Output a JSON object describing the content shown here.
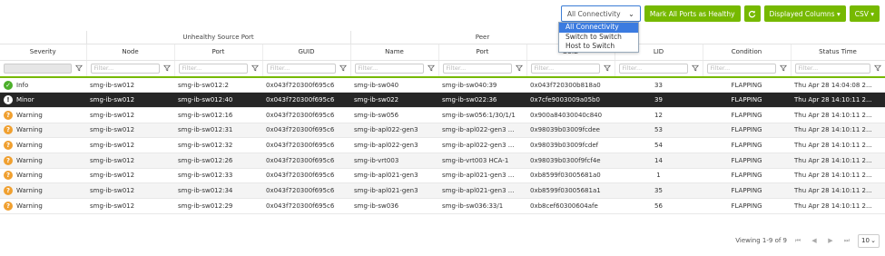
{
  "toolbar": {
    "connectivity_value": "All Connectivity",
    "mark_label": "Mark All Ports as Healthy",
    "refresh_icon": "refresh-icon",
    "displayed_columns_label": "Displayed Columns ▾",
    "csv_label": "CSV ▾"
  },
  "dropdown": {
    "options": [
      "All Connectivity",
      "Switch to Switch",
      "Host to Switch"
    ]
  },
  "groups": {
    "unhealthy": "Unhealthy Source Port",
    "peer": "Peer"
  },
  "columns": [
    "Severity",
    "Node",
    "Port",
    "GUID",
    "Name",
    "Port",
    "GUID",
    "LID",
    "Condition",
    "Status Time"
  ],
  "filter_placeholder": "Filter...",
  "rows": [
    {
      "severity": "Info",
      "node": "smg-ib-sw012",
      "port": "smg-ib-sw012:2",
      "guid": "0x043f720300f695c6",
      "peer_name": "smg-ib-sw040",
      "peer_port": "smg-ib-sw040:39",
      "peer_guid": "0x043f720300b818a0",
      "lid": "33",
      "condition": "FLAPPING",
      "time": "Thu Apr 28 14:04:08 2..."
    },
    {
      "severity": "Minor",
      "node": "smg-ib-sw012",
      "port": "smg-ib-sw012:40",
      "guid": "0x043f720300f695c6",
      "peer_name": "smg-ib-sw022",
      "peer_port": "smg-ib-sw022:36",
      "peer_guid": "0x7cfe9003009a05b0",
      "lid": "39",
      "condition": "FLAPPING",
      "time": "Thu Apr 28 14:10:11 2..."
    },
    {
      "severity": "Warning",
      "node": "smg-ib-sw012",
      "port": "smg-ib-sw012:16",
      "guid": "0x043f720300f695c6",
      "peer_name": "smg-ib-sw056",
      "peer_port": "smg-ib-sw056:1/30/1/1",
      "peer_guid": "0x900a84030040c840",
      "lid": "12",
      "condition": "FLAPPING",
      "time": "Thu Apr 28 14:10:11 2..."
    },
    {
      "severity": "Warning",
      "node": "smg-ib-sw012",
      "port": "smg-ib-sw012:31",
      "guid": "0x043f720300f695c6",
      "peer_name": "smg-ib-apl022-gen3",
      "peer_port": "smg-ib-apl022-gen3 ...",
      "peer_guid": "0x98039b03009fcdee",
      "lid": "53",
      "condition": "FLAPPING",
      "time": "Thu Apr 28 14:10:11 2..."
    },
    {
      "severity": "Warning",
      "node": "smg-ib-sw012",
      "port": "smg-ib-sw012:32",
      "guid": "0x043f720300f695c6",
      "peer_name": "smg-ib-apl022-gen3",
      "peer_port": "smg-ib-apl022-gen3 ...",
      "peer_guid": "0x98039b03009fcdef",
      "lid": "54",
      "condition": "FLAPPING",
      "time": "Thu Apr 28 14:10:11 2..."
    },
    {
      "severity": "Warning",
      "node": "smg-ib-sw012",
      "port": "smg-ib-sw012:26",
      "guid": "0x043f720300f695c6",
      "peer_name": "smg-ib-vrt003",
      "peer_port": "smg-ib-vrt003 HCA-1",
      "peer_guid": "0x98039b0300f9fcf4e",
      "lid": "14",
      "condition": "FLAPPING",
      "time": "Thu Apr 28 14:10:11 2..."
    },
    {
      "severity": "Warning",
      "node": "smg-ib-sw012",
      "port": "smg-ib-sw012:33",
      "guid": "0x043f720300f695c6",
      "peer_name": "smg-ib-apl021-gen3",
      "peer_port": "smg-ib-apl021-gen3 ...",
      "peer_guid": "0xb8599f03005681a0",
      "lid": "1",
      "condition": "FLAPPING",
      "time": "Thu Apr 28 14:10:11 2..."
    },
    {
      "severity": "Warning",
      "node": "smg-ib-sw012",
      "port": "smg-ib-sw012:34",
      "guid": "0x043f720300f695c6",
      "peer_name": "smg-ib-apl021-gen3",
      "peer_port": "smg-ib-apl021-gen3 ...",
      "peer_guid": "0xb8599f03005681a1",
      "lid": "35",
      "condition": "FLAPPING",
      "time": "Thu Apr 28 14:10:11 2..."
    },
    {
      "severity": "Warning",
      "node": "smg-ib-sw012",
      "port": "smg-ib-sw012:29",
      "guid": "0x043f720300f695c6",
      "peer_name": "smg-ib-sw036",
      "peer_port": "smg-ib-sw036:33/1",
      "peer_guid": "0xb8cef60300604afe",
      "lid": "56",
      "condition": "FLAPPING",
      "time": "Thu Apr 28 14:10:11 2..."
    }
  ],
  "pager": {
    "viewing": "Viewing 1-9 of 9",
    "page_size": "10"
  },
  "colors": {
    "accent": "#76b900",
    "selected_row": "#262626",
    "info": "#4caf2b",
    "warning": "#f0a030",
    "select_border": "#3c7dd6"
  }
}
